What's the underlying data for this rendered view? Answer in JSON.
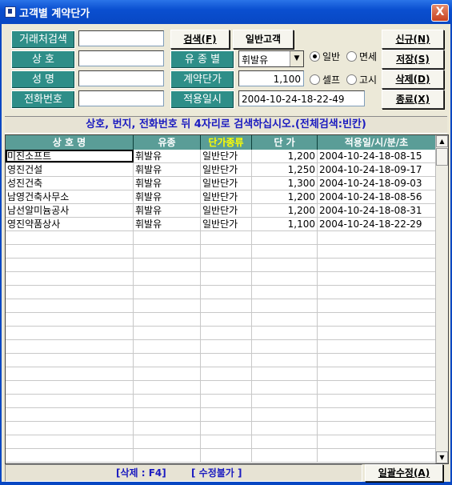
{
  "window": {
    "title": "고객별 계약단가",
    "close_label": "X"
  },
  "labels": {
    "customer_search": "거래처검색",
    "trade_name": "상    호",
    "name": "성    명",
    "phone": "전화번호",
    "fuel_type": "유 종 별",
    "contract_price": "계약단가",
    "apply_date": "적용일시"
  },
  "fields": {
    "customer_search": "",
    "trade_name": "",
    "name": "",
    "phone": "",
    "fuel_type": "휘발유",
    "contract_price": "1,100",
    "apply_date": "2004-10-24-18-22-49"
  },
  "buttons": {
    "search": "검색(F)",
    "general_customer": "일반고객",
    "new": "신규(N)",
    "save": "저장(S)",
    "delete": "삭제(D)",
    "exit": "종료(X)",
    "bulk_edit": "일괄수정(A)"
  },
  "radios": {
    "general": "일반",
    "tax_free": "면세",
    "self": "셀프",
    "premium": "고시",
    "selected_group1": "일반",
    "selected_group2": ""
  },
  "message": "상호, 번지, 전화번호 뒤 4자리로 검색하십시오.(전체검색:빈칸)",
  "grid": {
    "headers": [
      "상 호 명",
      "유종",
      "단가종류",
      "단   가",
      "적용일/시/분/초"
    ],
    "rows": [
      [
        "미진소프트",
        "휘발유",
        "일반단가",
        "1,200",
        "2004-10-24-18-08-15"
      ],
      [
        "영진건설",
        "휘발유",
        "일반단가",
        "1,250",
        "2004-10-24-18-09-17"
      ],
      [
        "성진건축",
        "휘발유",
        "일반단가",
        "1,300",
        "2004-10-24-18-09-03"
      ],
      [
        "남영건축사무소",
        "휘발유",
        "일반단가",
        "1,200",
        "2004-10-24-18-08-56"
      ],
      [
        "남선알미늄공사",
        "휘발유",
        "일반단가",
        "1,200",
        "2004-10-24-18-08-31"
      ],
      [
        "영진약품상사",
        "휘발유",
        "일반단가",
        "1,100",
        "2004-10-24-18-22-29"
      ]
    ]
  },
  "footer": {
    "delete_hint": "[삭제 : F4]",
    "edit_hint": "[ 수정불가 ]"
  }
}
